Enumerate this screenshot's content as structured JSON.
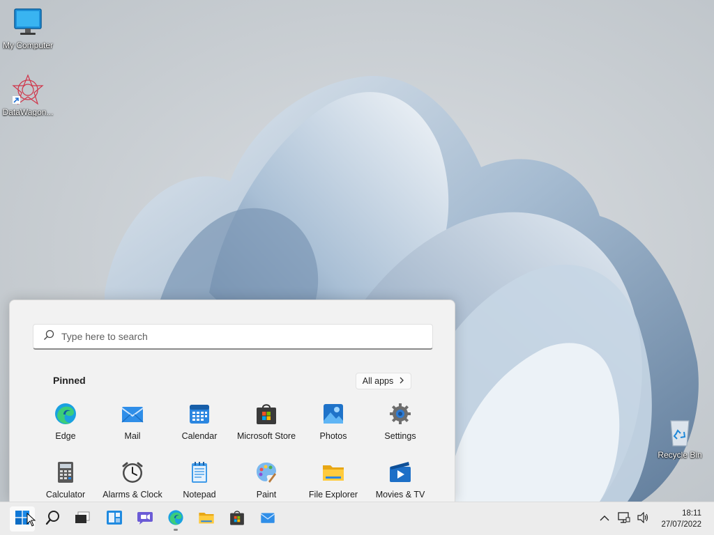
{
  "desktop": {
    "icons": [
      {
        "label": "My Computer",
        "icon": "monitor-icon"
      },
      {
        "label": "DataWagon...",
        "icon": "datawagon-icon"
      },
      {
        "label": "Recycle Bin",
        "icon": "recycle-bin-icon"
      }
    ]
  },
  "start_menu": {
    "search_placeholder": "Type here to search",
    "pinned_title": "Pinned",
    "all_apps_label": "All apps",
    "pinned": [
      {
        "label": "Edge",
        "icon": "edge-icon"
      },
      {
        "label": "Mail",
        "icon": "mail-icon"
      },
      {
        "label": "Calendar",
        "icon": "calendar-icon"
      },
      {
        "label": "Microsoft Store",
        "icon": "store-icon"
      },
      {
        "label": "Photos",
        "icon": "photos-icon"
      },
      {
        "label": "Settings",
        "icon": "settings-icon"
      },
      {
        "label": "Calculator",
        "icon": "calculator-icon"
      },
      {
        "label": "Alarms & Clock",
        "icon": "clock-icon"
      },
      {
        "label": "Notepad",
        "icon": "notepad-icon"
      },
      {
        "label": "Paint",
        "icon": "paint-icon"
      },
      {
        "label": "File Explorer",
        "icon": "folder-icon"
      },
      {
        "label": "Movies & TV",
        "icon": "movies-icon"
      }
    ]
  },
  "taskbar": {
    "apps": [
      "start-icon",
      "search-icon",
      "task-view-icon",
      "widgets-icon",
      "chat-icon",
      "edge-icon",
      "folder-icon",
      "store-icon",
      "mail-icon"
    ],
    "clock": {
      "time": "18:11",
      "date": "27/07/2022"
    }
  },
  "colors": {
    "accent": "#0067c0",
    "taskbar": "#ececec",
    "start_bg": "#f2f2f2"
  }
}
